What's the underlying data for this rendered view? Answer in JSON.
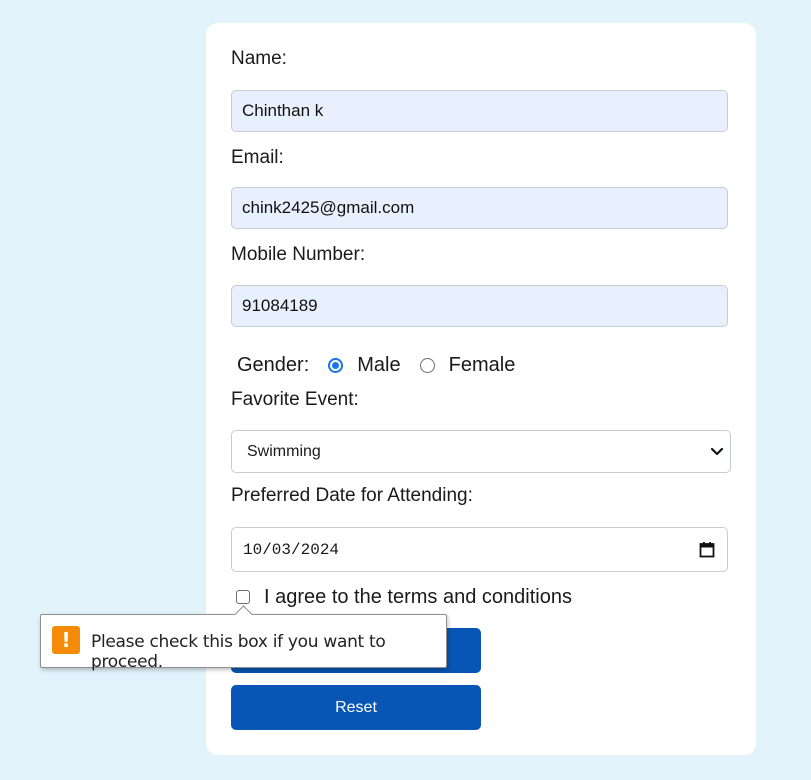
{
  "form": {
    "name_label": "Name:",
    "name_value": "Chinthan k",
    "email_label": "Email:",
    "email_value": "chink2425@gmail.com",
    "mobile_label": "Mobile Number:",
    "mobile_value": "91084189",
    "gender": {
      "label": "Gender:",
      "options": [
        {
          "label": "Male",
          "checked": true
        },
        {
          "label": "Female",
          "checked": false
        }
      ]
    },
    "event_label": "Favorite Event:",
    "event_selected": "Swimming",
    "date_label": "Preferred Date for Attending:",
    "date_value": "10/03/2024",
    "terms_label": "I agree to the terms and conditions",
    "terms_checked": false,
    "submit_label": "",
    "reset_label": "Reset"
  },
  "validation_tooltip": {
    "icon": "warning-icon",
    "message": "Please check this box if you want to proceed."
  },
  "colors": {
    "background": "#e3f3fc",
    "button": "#0756b5",
    "autofill": "#e8f0fe",
    "radio_accent": "#1a73e8",
    "warning": "#f58a07"
  }
}
